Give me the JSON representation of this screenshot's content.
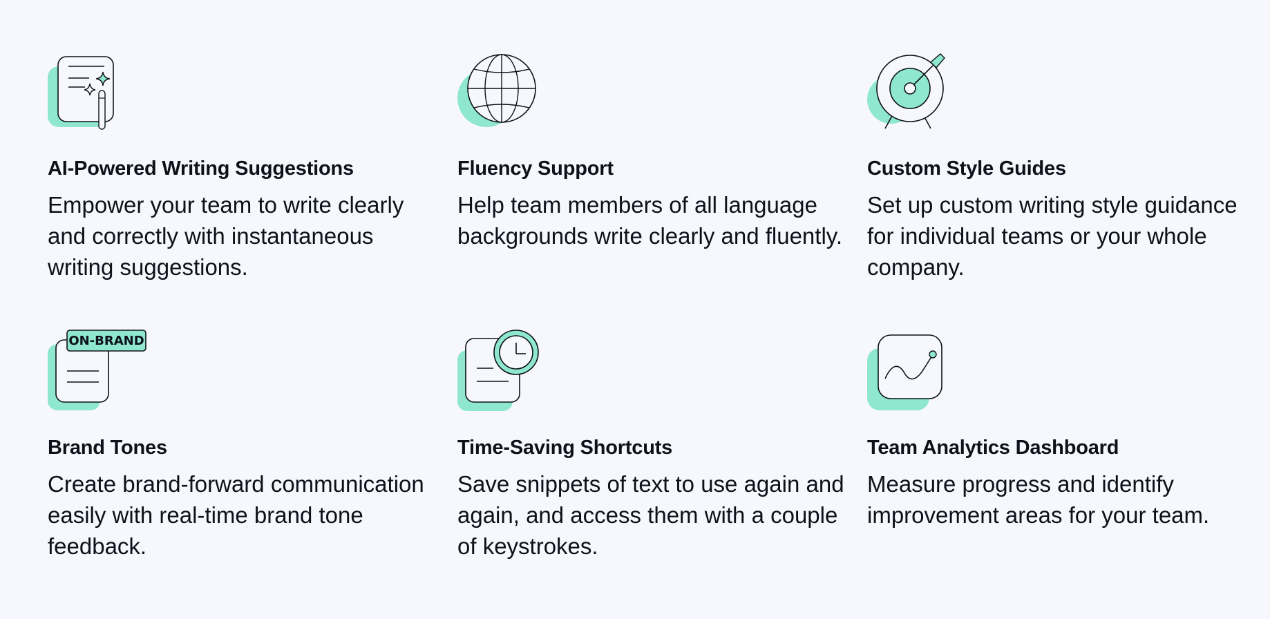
{
  "accent_color": "#8ee7ce",
  "outline_color": "#0e101a",
  "features": [
    {
      "icon": "document-sparkle-pen-icon",
      "title": "AI-Powered Writing Suggestions",
      "description": "Empower your team to write clearly and correctly with instantaneous writing suggestions."
    },
    {
      "icon": "globe-icon",
      "title": "Fluency Support",
      "description": "Help team members of all language backgrounds write clearly and fluently."
    },
    {
      "icon": "target-icon",
      "title": "Custom Style Guides",
      "description": "Set up custom writing style guidance for individual teams or your whole company."
    },
    {
      "icon": "on-brand-document-icon",
      "badge": "ON-BRAND",
      "title": "Brand Tones",
      "description": "Create brand-forward communication easily with real-time brand tone feedback."
    },
    {
      "icon": "document-clock-icon",
      "title": "Time-Saving Shortcuts",
      "description": "Save snippets of text to use again and again, and access them with a couple of keystrokes."
    },
    {
      "icon": "analytics-chart-icon",
      "title": "Team Analytics Dashboard",
      "description": "Measure progress and identify improvement areas for your team."
    }
  ]
}
